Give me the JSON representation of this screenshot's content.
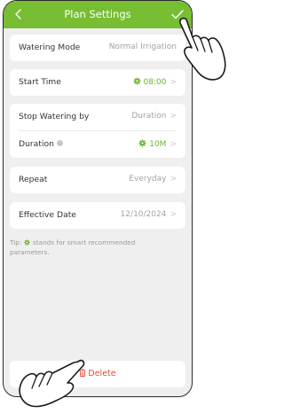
{
  "header": {
    "title": "Plan Settings"
  },
  "icons": {
    "back": "chevron-left-icon",
    "confirm": "checkmark-icon",
    "smart": "gear-icon",
    "info": "info-icon",
    "trash": "trash-icon",
    "pointer": "pointing-hand-icon"
  },
  "colors": {
    "accent": "#77be32",
    "smart_value": "#6cb52b",
    "delete": "#e24a3a",
    "background": "#efefef"
  },
  "rows": {
    "watering_mode": {
      "label": "Watering Mode",
      "value": "Normal Irrigation"
    },
    "start_time": {
      "label": "Start Time",
      "value": "08:00"
    },
    "stop_watering_by": {
      "label": "Stop Watering by",
      "value": "Duration"
    },
    "duration": {
      "label": "Duration",
      "value": "10M"
    },
    "repeat": {
      "label": "Repeat",
      "value": "Everyday"
    },
    "effective_date": {
      "label": "Effective Date",
      "value": "12/10/2024"
    }
  },
  "tip": {
    "prefix": "Tip:",
    "text": "stands for smart recommended parameters."
  },
  "actions": {
    "delete_label": "Delete"
  }
}
